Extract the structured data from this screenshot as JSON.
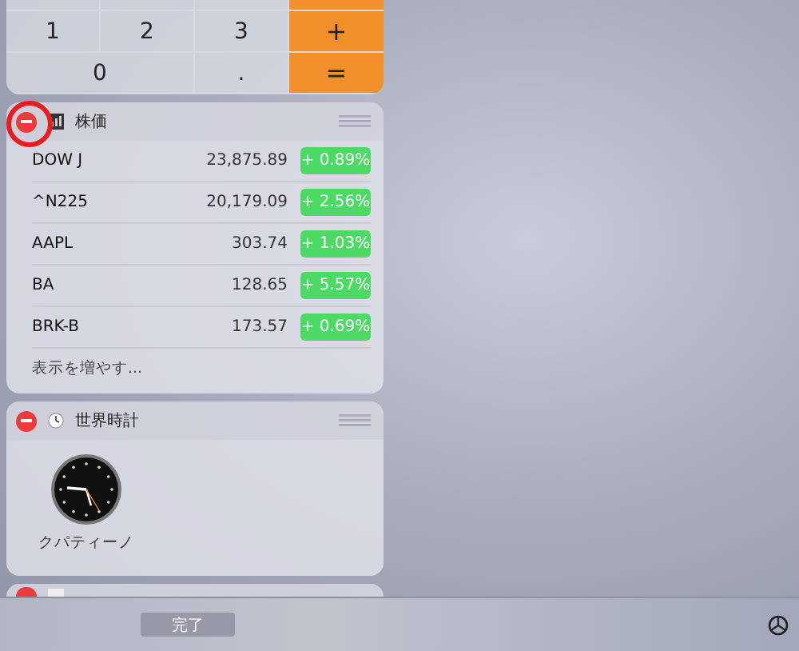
{
  "calculator": {
    "keys": [
      {
        "label": "1",
        "kind": "digit"
      },
      {
        "label": "2",
        "kind": "digit"
      },
      {
        "label": "3",
        "kind": "digit"
      },
      {
        "label": "+",
        "kind": "operator"
      },
      {
        "label": "0",
        "kind": "wide"
      },
      {
        "label": ".",
        "kind": "digit"
      },
      {
        "label": "=",
        "kind": "operator"
      }
    ]
  },
  "stocks": {
    "title": "株価",
    "highlighted": true,
    "rows": [
      {
        "symbol": "DOW J",
        "price": "23,875.89",
        "change": "+ 0.89%"
      },
      {
        "symbol": "^N225",
        "price": "20,179.09",
        "change": "+ 2.56%"
      },
      {
        "symbol": "AAPL",
        "price": "303.74",
        "change": "+ 1.03%"
      },
      {
        "symbol": "BA",
        "price": "128.65",
        "change": "+ 5.57%"
      },
      {
        "symbol": "BRK-B",
        "price": "173.57",
        "change": "+ 0.69%"
      }
    ],
    "more": "表示を増やす..."
  },
  "world_clock": {
    "title": "世界時計",
    "clocks": [
      {
        "city": "クパティーノ"
      }
    ]
  },
  "bottom_bar": {
    "done": "完了"
  }
}
